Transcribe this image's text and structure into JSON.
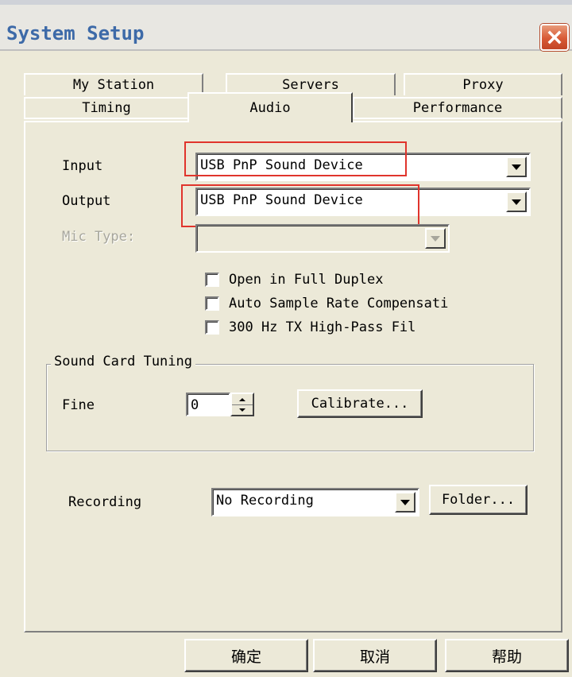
{
  "window": {
    "title": "System Setup"
  },
  "tabs": {
    "row1": [
      {
        "label": "My Station"
      },
      {
        "label": "Servers"
      },
      {
        "label": "Proxy"
      }
    ],
    "row2": [
      {
        "label": "Timing"
      },
      {
        "label": "Audio",
        "selected": true
      },
      {
        "label": "Performance"
      }
    ]
  },
  "audio": {
    "input": {
      "label": "Input",
      "value": "USB PnP Sound Device"
    },
    "output": {
      "label": "Output",
      "value": "USB PnP Sound Device"
    },
    "mic_type": {
      "label": "Mic Type:",
      "value": "",
      "enabled": false
    },
    "checkboxes": [
      {
        "label": "Open in Full Duplex",
        "checked": false
      },
      {
        "label": "Auto Sample Rate Compensati",
        "checked": false
      },
      {
        "label": "300 Hz TX High-Pass Fil",
        "checked": false
      }
    ],
    "tuning": {
      "group_label": "Sound Card Tuning",
      "fine_label": "Fine",
      "fine_value": "0",
      "calibrate_label": "Calibrate..."
    },
    "recording": {
      "label": "Recording",
      "value": "No Recording",
      "folder_label": "Folder..."
    }
  },
  "footer": {
    "ok_label": "确定",
    "cancel_label": "取消",
    "help_label": "帮助"
  },
  "colors": {
    "title_text": "#3d6aa8",
    "highlight_box": "#e0342c",
    "dialog_bg": "#ece9d8",
    "close_button": "#d85a36"
  },
  "icons": [
    "close-icon",
    "dropdown-arrow-icon",
    "spin-up-icon",
    "spin-down-icon"
  ]
}
